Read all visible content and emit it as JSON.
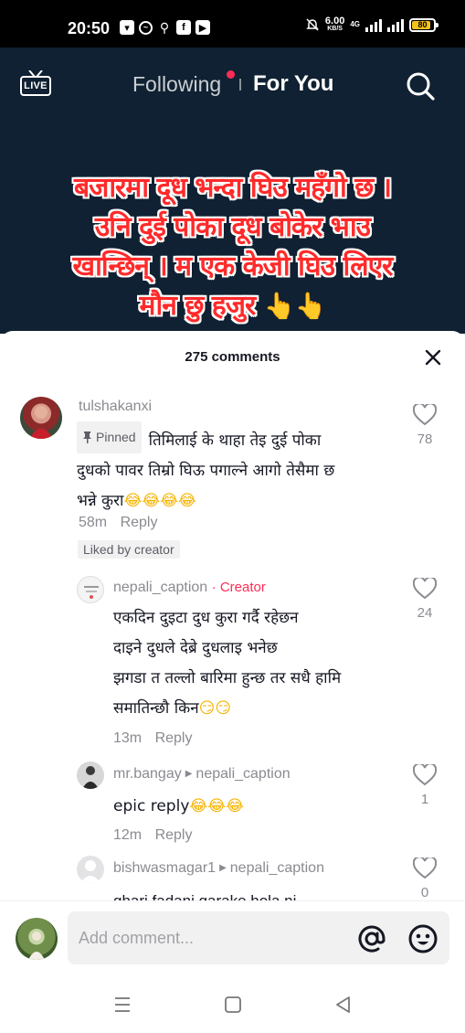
{
  "status_bar": {
    "time": "20:50",
    "net_speed": "6.00",
    "net_unit": "KB/S",
    "net_type": "4G",
    "battery": "80",
    "battery_level": 0.8
  },
  "top_nav": {
    "live_label": "LIVE",
    "following": "Following",
    "for_you": "For You"
  },
  "video_caption": {
    "lines": [
      "बजारमा दूध भन्दा घिउ महँगो छ ।",
      "उनि दुई पोका दूध बोकेर भाउ",
      "खान्छिन् । म एक केजी घिउ लिएर",
      "मौन छु हजुर"
    ],
    "emoji": "👆👆"
  },
  "comments_sheet": {
    "count_label": "275 comments",
    "comments": [
      {
        "username": "tulshakanxi",
        "pinned_label": "Pinned",
        "line1": "तिमिलाई के थाहा तेइ दुई पोका",
        "line2": "दुधको पावर तिम्रो घिऊ पगाल्ने आगो तेसैमा छ",
        "line3": "भन्ने कुरा",
        "emoji": "😂😂😂😂",
        "time": "58m",
        "reply": "Reply",
        "liked_by": "Liked by creator",
        "likes": "78"
      },
      {
        "username": "nepali_caption",
        "creator_tag": "· Creator",
        "line1": "एकदिन दुइटा दुध कुरा गर्दै रहेछन",
        "line2": "दाइने दुधले देब्रे दुधलाइ भनेछ",
        "line3": "झगडा त तल्लो बारिमा हुन्छ तर सधै हामि",
        "line4": "समातिन्छौ किन",
        "emoji": "😏😏",
        "time": "13m",
        "reply": "Reply",
        "likes": "24"
      },
      {
        "username": "mr.bangay",
        "reply_to": "nepali_caption",
        "line1": "epic reply",
        "emoji": "😂😂😂",
        "time": "12m",
        "reply": "Reply",
        "likes": "1"
      },
      {
        "username": "bishwasmagar1",
        "reply_to": "nepali_caption",
        "line1": "ghari fadani garake hola ni",
        "likes": "0"
      }
    ]
  },
  "input_bar": {
    "placeholder": "Add comment..."
  },
  "icons": {
    "live": "live-tv-icon",
    "search": "search-icon",
    "close": "close-icon",
    "heart": "heart-outline-icon",
    "pin": "pin-icon",
    "mention": "at-sign-icon",
    "emoji": "smiley-icon",
    "menu": "menu-lines-icon",
    "home": "square-home-icon",
    "back": "triangle-back-icon"
  },
  "colors": {
    "accent": "#fe2c55",
    "caption_red": "#ff2a2a",
    "video_bg": "#0f2132"
  }
}
